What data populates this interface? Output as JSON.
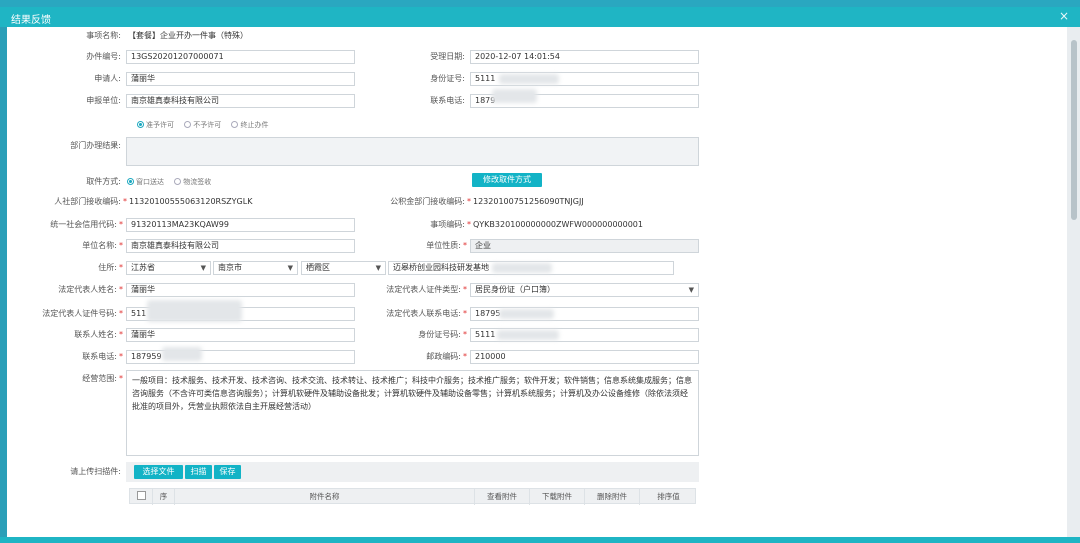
{
  "window": {
    "title": "结果反馈",
    "close": "×"
  },
  "form": {
    "item_name": {
      "label": "事项名称:",
      "value": "【套餐】企业开办一件事（特殊）"
    },
    "case_no": {
      "label": "办件编号:",
      "value": "13GS20201207000071"
    },
    "accept_date": {
      "label": "受理日期:",
      "value": "2020-12-07 14:01:54"
    },
    "applicant": {
      "label": "申请人:",
      "value": "蒲丽华"
    },
    "id_no": {
      "label": "身份证号:",
      "value": "5111"
    },
    "unit": {
      "label": "申报单位:",
      "value": "南京雄真泰科技有限公司"
    },
    "phone": {
      "label": "联系电话:",
      "value": "1879"
    },
    "decision": {
      "options": [
        "准予许可",
        "不予许可",
        "终止办件"
      ],
      "selected": "准予许可"
    },
    "dept_result": {
      "label": "部门办理结果:",
      "value": ""
    },
    "pickup": {
      "label": "取件方式:",
      "options": [
        "窗口送达",
        "物流签收"
      ],
      "selected": "窗口送达",
      "modify_button": "修改取件方式"
    },
    "hrss_code": {
      "label": "人社部门接收编码:",
      "value": "11320100555063120RSZYGLK"
    },
    "fund_code": {
      "label": "公积金部门接收编码:",
      "value": "12320100751256090TNJGJJ"
    },
    "credit_code": {
      "label": "统一社会信用代码:",
      "value": "91320113MA23KQAW99"
    },
    "matter_code": {
      "label": "事项编码:",
      "value": "QYKB320100000000ZWFW000000000001"
    },
    "unit_name": {
      "label": "单位名称:",
      "value": "南京雄真泰科技有限公司"
    },
    "unit_nature": {
      "label": "单位性质:",
      "value": "企业"
    },
    "address": {
      "label": "住所:",
      "province": "江苏省",
      "city": "南京市",
      "district": "栖霞区",
      "detail": "迈皋桥创业园科技研发基地"
    },
    "legal_name": {
      "label": "法定代表人姓名:",
      "value": "蒲丽华"
    },
    "legal_id_type": {
      "label": "法定代表人证件类型:",
      "value": "居民身份证（户口簿）"
    },
    "legal_id_no": {
      "label": "法定代表人证件号码:",
      "value": "511"
    },
    "legal_phone": {
      "label": "法定代表人联系电话:",
      "value": "18795"
    },
    "contact_name": {
      "label": "联系人姓名:",
      "value": "蒲丽华"
    },
    "contact_id": {
      "label": "身份证号码:",
      "value": "5111"
    },
    "contact_phone": {
      "label": "联系电话:",
      "value": "187959"
    },
    "postcode": {
      "label": "邮政编码:",
      "value": "210000"
    },
    "scope": {
      "label": "经营范围:",
      "value": "一般项目：技术服务、技术开发、技术咨询、技术交流、技术转让、技术推广；科技中介服务；技术推广服务；软件开发；软件销售；信息系统集成服务；信息咨询服务（不含许可类信息咨询服务）；计算机软硬件及辅助设备批发；计算机软硬件及辅助设备零售；计算机系统服务；计算机及办公设备维修（除依法须经批准的项目外，凭营业执照依法自主开展经营活动）"
    },
    "upload": {
      "label": "请上传扫描件:",
      "buttons": [
        "选择文件",
        "扫描",
        "保存"
      ],
      "columns": [
        "序",
        "附件名称",
        "查看附件",
        "下载附件",
        "删除附件",
        "排序值"
      ]
    }
  },
  "colors": {
    "accent": "#12b3c6",
    "title_bar": "#1fb5c4",
    "required": "#e03131"
  }
}
